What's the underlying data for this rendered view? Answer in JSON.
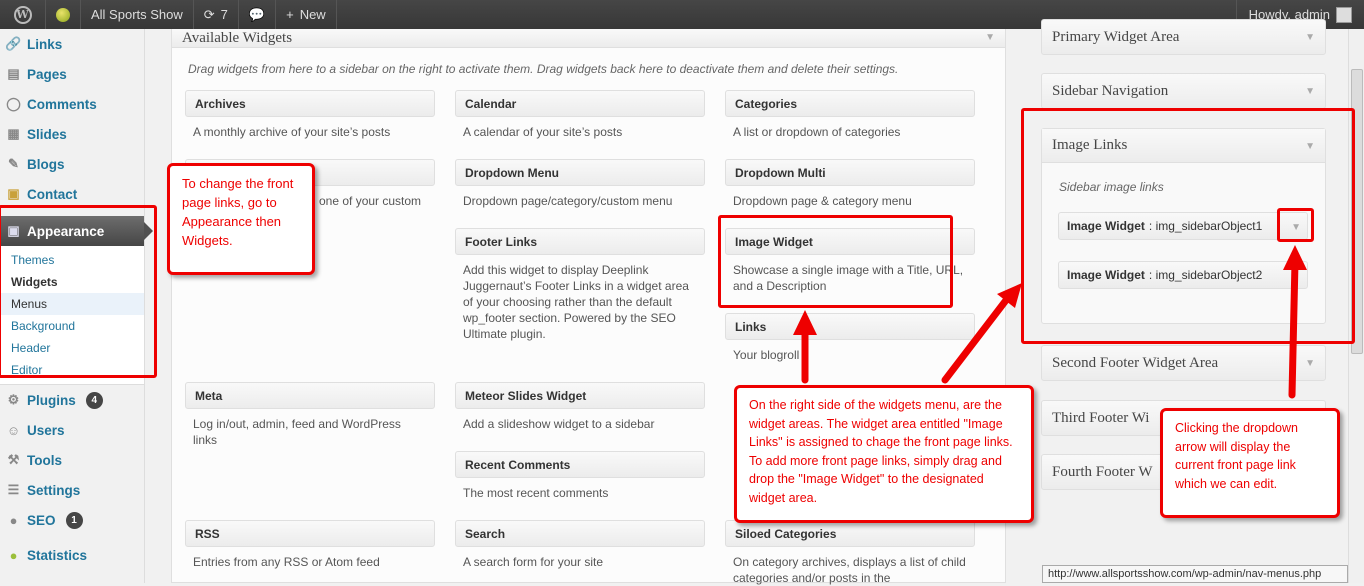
{
  "adminbar": {
    "site_name": "All Sports Show",
    "updates_count": "7",
    "new_label": "New",
    "howdy": "Howdy, admin"
  },
  "sidebar": {
    "items_top": [
      {
        "label": "Links",
        "icon": "link-icon"
      },
      {
        "label": "Pages",
        "icon": "pages-icon"
      },
      {
        "label": "Comments",
        "icon": "comments-icon"
      },
      {
        "label": "Slides",
        "icon": "slides-icon"
      },
      {
        "label": "Blogs",
        "icon": "blogs-icon"
      },
      {
        "label": "Contact",
        "icon": "contact-icon"
      }
    ],
    "appearance": "Appearance",
    "submenu": [
      "Themes",
      "Widgets",
      "Menus",
      "Background",
      "Header",
      "Editor"
    ],
    "items_bottom": [
      {
        "label": "Plugins",
        "icon": "plugins-icon",
        "badge": "4"
      },
      {
        "label": "Users",
        "icon": "users-icon"
      },
      {
        "label": "Tools",
        "icon": "tools-icon"
      },
      {
        "label": "Settings",
        "icon": "settings-icon"
      },
      {
        "label": "SEO",
        "icon": "seo-icon",
        "badge": "1"
      },
      {
        "label": "Statistics",
        "icon": "statistics-icon"
      }
    ]
  },
  "available": {
    "title": "Available Widgets",
    "description": "Drag widgets from here to a sidebar on the right to activate them. Drag widgets back here to deactivate them and delete their settings.",
    "widgets": {
      "archives": {
        "title": "Archives",
        "desc": "A monthly archive of your site’s posts"
      },
      "calendar": {
        "title": "Calendar",
        "desc": "A calendar of your site’s posts"
      },
      "categories": {
        "title": "Categories",
        "desc": "A list or dropdown of categories"
      },
      "custom_menu": {
        "title": "",
        "desc": "one of your custom"
      },
      "dropdown_menu": {
        "title": "Dropdown Menu",
        "desc": "Dropdown page/category/custom menu"
      },
      "dropdown_multi": {
        "title": "Dropdown Multi",
        "desc": "Dropdown page & category menu"
      },
      "footer_links": {
        "title": "Footer Links",
        "desc": "Add this widget to display Deeplink Juggernaut’s Footer Links in a widget area of your choosing rather than the default wp_footer section. Powered by the SEO Ultimate plugin."
      },
      "image_widget": {
        "title": "Image Widget",
        "desc": "Showcase a single image with a Title, URL, and a Description"
      },
      "links": {
        "title": "Links",
        "desc": "Your blogroll"
      },
      "meta": {
        "title": "Meta",
        "desc": "Log in/out, admin, feed and WordPress links"
      },
      "meteor": {
        "title": "Meteor Slides Widget",
        "desc": "Add a slideshow widget to a sidebar"
      },
      "recent_comments": {
        "title": "Recent Comments",
        "desc": "The most recent comments"
      },
      "rss": {
        "title": "RSS",
        "desc": "Entries from any RSS or Atom feed"
      },
      "search": {
        "title": "Search",
        "desc": "A search form for your site"
      },
      "siloed": {
        "title": "Siloed Categories",
        "desc": "On category archives, displays a list of child categories and/or posts in the"
      }
    }
  },
  "areas": {
    "primary": "Primary Widget Area",
    "sidebar_nav": "Sidebar Navigation",
    "image_links": "Image Links",
    "image_links_desc": "Sidebar image links",
    "image_widget_1_title": "Image Widget",
    "image_widget_1_name": ": img_sidebarObject1",
    "image_widget_2_title": "Image Widget",
    "image_widget_2_name": ": img_sidebarObject2",
    "second_footer": "Second Footer Widget Area",
    "third_footer": "Third Footer Wi",
    "fourth_footer": "Fourth Footer W"
  },
  "callouts": {
    "appearance": "To change the front page links, go to Appearance then Widgets.",
    "widget_areas": "On the right side of the widgets menu, are the widget areas. The widget area entitled \"Image Links\" is assigned to chage the front page links. To add more front page links, simply drag and drop the \"Image Widget\" to the designated widget area.",
    "dropdown": "Clicking the dropdown arrow will display the current front page link which we can edit."
  },
  "status_url": "http://www.allsportsshow.com/wp-admin/nav-menus.php",
  "colors": {
    "annotation_red": "#e00000",
    "link_blue": "#21759b",
    "adminbar": "#464646"
  }
}
